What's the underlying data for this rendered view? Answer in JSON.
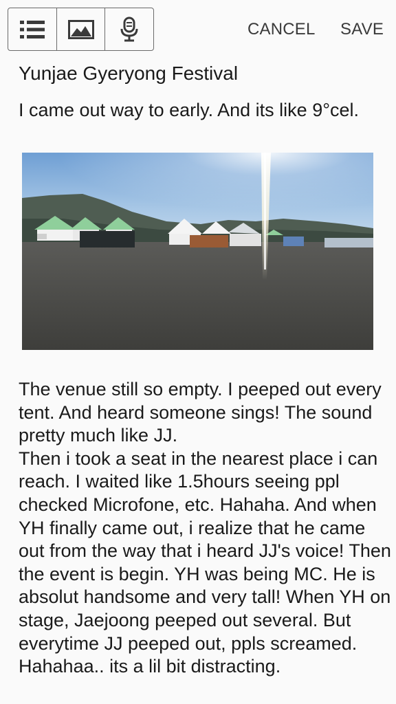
{
  "toolbar": {
    "icons": [
      "list-icon",
      "image-icon",
      "microphone-icon"
    ],
    "cancel_label": "CANCEL",
    "save_label": "SAVE"
  },
  "note": {
    "title": "Yunjae Gyeryong Festival",
    "intro": "I came out way to early. And its like 9°cel.",
    "body": "The venue still so empty. I peeped out every tent. And heard someone sings! The sound pretty much like JJ.\nThen i took a seat in the nearest place i can reach. I waited like 1.5hours seeing ppl checked Microfone, etc. Hahaha. And when YH finally came out, i realize that he came out from the way that i heard JJ's voice! Then the event is begin. YH was being MC. He is absolut handsome and very tall! When YH on stage, Jaejoong peeped out several. But everytime JJ peeped out, ppls screamed. Hahahaa.. its a lil bit distracting."
  },
  "colors": {
    "background": "#fafafa",
    "text": "#1a1a1a",
    "border": "#6a6a6a"
  }
}
